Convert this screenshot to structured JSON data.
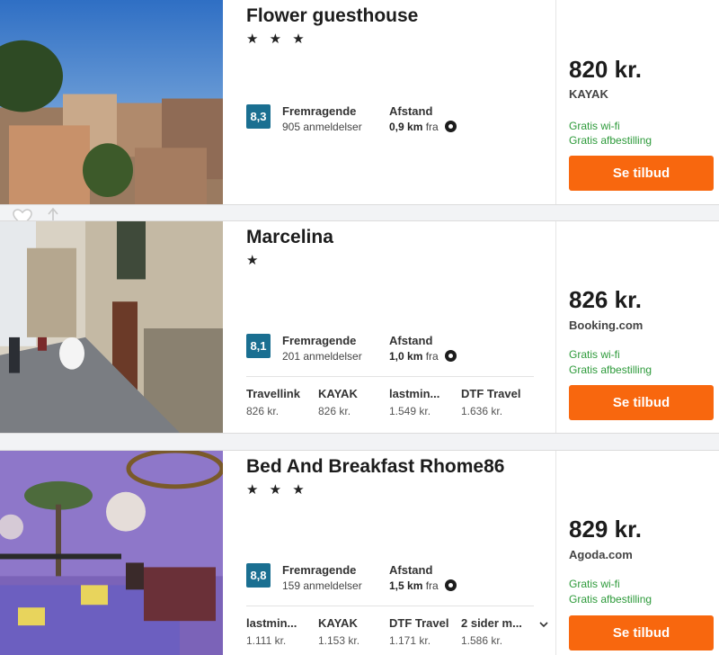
{
  "hotels": [
    {
      "name": "Flower guesthouse",
      "stars": "★ ★ ★",
      "score": "8,3",
      "score_label": "Fremragende",
      "reviews": "905 anmeldelser",
      "distance_label": "Afstand",
      "distance_value": "0,9 km",
      "distance_suffix": "fra",
      "price": "820 kr.",
      "provider": "KAYAK",
      "perks": [
        "Gratis wi-fi",
        "Gratis afbestilling"
      ],
      "cta": "Se tilbud",
      "offers": []
    },
    {
      "name": "Marcelina",
      "stars": "★",
      "score": "8,1",
      "score_label": "Fremragende",
      "reviews": "201 anmeldelser",
      "distance_label": "Afstand",
      "distance_value": "1,0 km",
      "distance_suffix": "fra",
      "price": "826 kr.",
      "provider": "Booking.com",
      "perks": [
        "Gratis wi-fi",
        "Gratis afbestilling"
      ],
      "cta": "Se tilbud",
      "offers": [
        {
          "name": "Travellink",
          "price": "826 kr."
        },
        {
          "name": "KAYAK",
          "price": "826 kr."
        },
        {
          "name": "lastmin...",
          "price": "1.549 kr."
        },
        {
          "name": "DTF Travel",
          "price": "1.636 kr."
        }
      ]
    },
    {
      "name": "Bed And Breakfast Rhome86",
      "stars": "★ ★ ★",
      "score": "8,8",
      "score_label": "Fremragende",
      "reviews": "159 anmeldelser",
      "distance_label": "Afstand",
      "distance_value": "1,5 km",
      "distance_suffix": "fra",
      "price": "829 kr.",
      "provider": "Agoda.com",
      "perks": [
        "Gratis wi-fi",
        "Gratis afbestilling"
      ],
      "cta": "Se tilbud",
      "offers": [
        {
          "name": "lastmin...",
          "price": "1.111 kr."
        },
        {
          "name": "KAYAK",
          "price": "1.153 kr."
        },
        {
          "name": "DTF Travel",
          "price": "1.171 kr."
        },
        {
          "name": "2 sider m...",
          "price": "1.586 kr."
        }
      ]
    }
  ],
  "icons": {
    "favorite": "heart-icon",
    "share": "share-icon",
    "distance": "location-pin-icon",
    "more": "chevron-down-icon"
  },
  "colors": {
    "score_badge": "#1a6f91",
    "deal_button": "#f8670e",
    "perk_text": "#2d9a3a"
  }
}
